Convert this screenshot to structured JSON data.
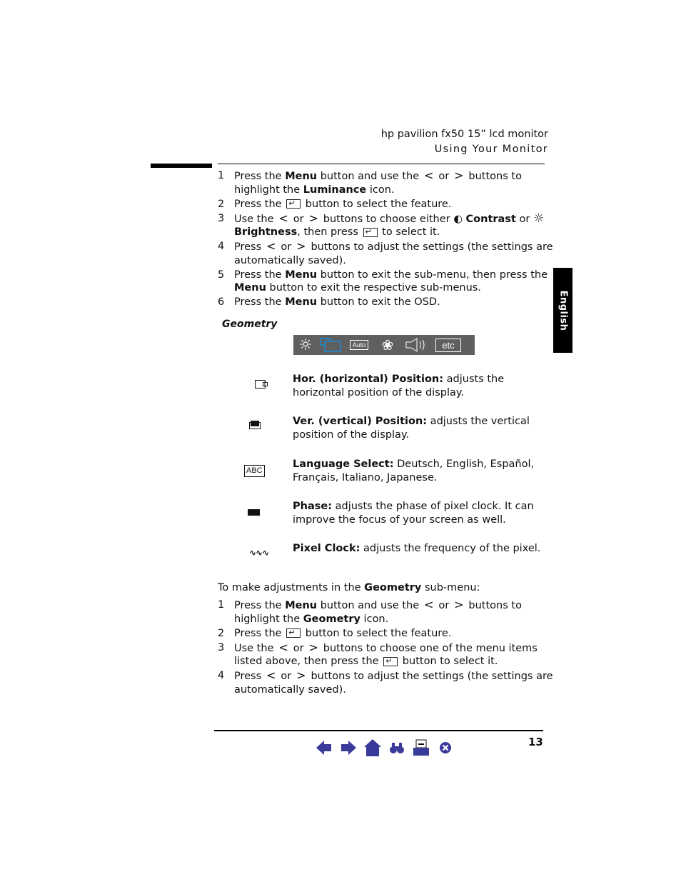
{
  "header": {
    "line1": "hp pavilion fx50 15” lcd monitor",
    "line2": "Using Your Monitor"
  },
  "side_tab": "English",
  "luminance_steps": [
    {
      "n": "1",
      "parts": [
        "Press the ",
        "Menu",
        " button and use the ",
        "<",
        " or ",
        ">",
        " buttons to highlight the ",
        "Luminance",
        " icon."
      ]
    },
    {
      "n": "2",
      "parts": [
        "Press the ",
        " button to select the feature."
      ]
    },
    {
      "n": "3",
      "parts": [
        "Use the ",
        "<",
        " or ",
        ">",
        " buttons to choose either ",
        "Contrast",
        " or ",
        "Brightness",
        ", then press ",
        " to select it."
      ]
    },
    {
      "n": "4",
      "parts": [
        "Press ",
        "<",
        " or ",
        ">",
        " buttons to adjust the settings (the settings are automatically saved)."
      ]
    },
    {
      "n": "5",
      "parts": [
        "Press the ",
        "Menu",
        " button to exit the sub-menu, then press the ",
        "Menu",
        " button to exit the respective sub-menus."
      ]
    },
    {
      "n": "6",
      "parts": [
        "Press the ",
        "Menu",
        " button to exit the OSD."
      ]
    }
  ],
  "geometry": {
    "title": "Geometry",
    "iconbar": [
      "brightness-icon",
      "geometry-icon",
      "auto-icon",
      "color-palette-icon",
      "volume-icon",
      "etc-icon"
    ],
    "iconbar_labels": {
      "auto": "Auto",
      "etc": "etc"
    },
    "items": [
      {
        "icon": "horizontal-position-icon",
        "label": "Hor. (horizontal) Position:",
        "desc": " adjusts the horizontal position of the display."
      },
      {
        "icon": "vertical-position-icon",
        "label": "Ver. (vertical) Position:",
        "desc": " adjusts the vertical position of the display."
      },
      {
        "icon": "language-icon",
        "icon_text": "ABC",
        "label": "Language Select:",
        "desc": " Deutsch, English, Español, Français, Italiano, Japanese."
      },
      {
        "icon": "phase-icon",
        "label": "Phase:",
        "desc": " adjusts the phase of pixel clock. It can improve the focus of your screen as well."
      },
      {
        "icon": "pixel-clock-icon",
        "label": "Pixel Clock:",
        "desc": " adjusts the frequency of the pixel."
      }
    ],
    "intro": [
      "To make adjustments in the ",
      "Geometry",
      " sub-menu:"
    ],
    "steps": [
      {
        "n": "1",
        "parts": [
          "Press the ",
          "Menu",
          " button and use the ",
          "<",
          " or ",
          ">",
          " buttons to highlight the ",
          "Geometry",
          " icon."
        ]
      },
      {
        "n": "2",
        "parts": [
          "Press the ",
          " button to select the feature."
        ]
      },
      {
        "n": "3",
        "parts": [
          "Use the ",
          "<",
          " or ",
          ">",
          " buttons to choose one of the menu items listed above, then press the ",
          " button to select it."
        ]
      },
      {
        "n": "4",
        "parts": [
          "Press ",
          "<",
          " or ",
          ">",
          " buttons to adjust the settings (the settings are automatically saved)."
        ]
      }
    ]
  },
  "footer": {
    "page_number": "13",
    "nav": [
      "previous-page",
      "next-page",
      "home",
      "search",
      "print",
      "exit"
    ],
    "nav_color": "#3a3a9a"
  }
}
